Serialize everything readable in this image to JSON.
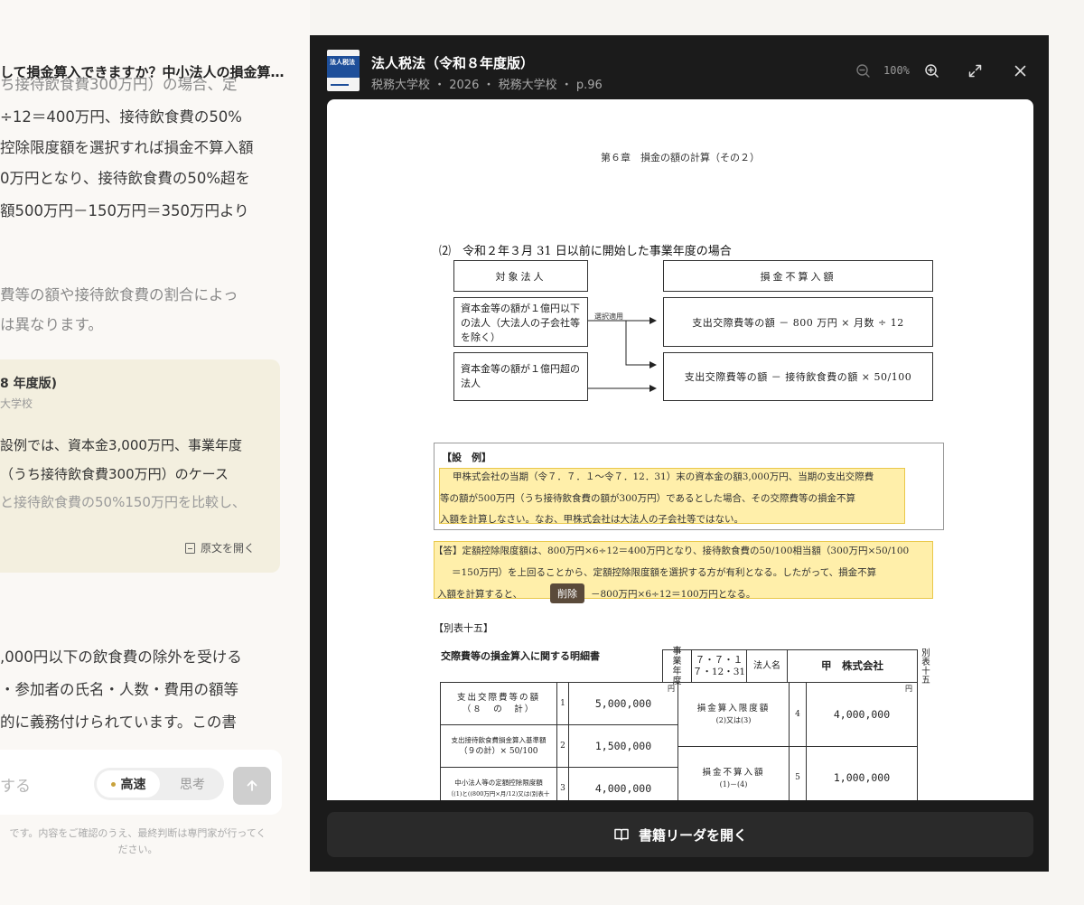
{
  "chat": {
    "answer_header": "して損金算入できますか？中小法人の損金算…",
    "lines": [
      "ち接待飲食費300万円）の場合、定",
      "÷12＝400万円、接待飲食費の50%",
      "控除限度額を選択すれば損金不算入額",
      "0万円となり、接待飲食費の50%超を",
      "額500万円－150万円＝350万円より",
      "費等の額や接待飲食費の割合によっ",
      "は異なります。",
      ",000円以下の飲食費の除外を受ける",
      "・参加者の氏名・人数・費用の額等",
      "的に義務付けられています。この書"
    ],
    "source_card": {
      "title": "8 年度版)",
      "subtitle": "大学校",
      "lines": [
        "設例では、資本金3,000万円、事業年度",
        "（うち接待飲食費300万円）のケース",
        "と接待飲食費の50%150万円を比較し、"
      ],
      "open_label": "原文を開く"
    },
    "input": {
      "placeholder": "する",
      "mode_fast": "高速",
      "mode_think": "思考"
    },
    "disclaimer": [
      "です。内容をご確認のうえ、最終判断は専門家が行ってく",
      "ださい。"
    ]
  },
  "viewer": {
    "book_thumb_text": "法人税法",
    "title": "法人税法（令和８年度版）",
    "meta": "税務大学校 ・ 2026 ・ 税務大学校 ・ p.96",
    "zoom": "100%",
    "open_reader_label": "書籍リーダを開く",
    "icons": {
      "zoom_out": "zoom-out-icon",
      "zoom_in": "zoom-in-icon",
      "expand": "expand-icon",
      "close": "close-icon",
      "book": "book-open-icon"
    }
  },
  "pdf": {
    "chapter": "第６章　損金の額の計算（その２）",
    "section": "⑵　令和２年３月 31 日以前に開始した事業年度の場合",
    "col_left": "対象法人",
    "col_right": "損金不算入額",
    "left_box_1": "資本金等の額が１億円以下の法人（大法人の子会社等を除く）",
    "left_box_2": "資本金等の額が１億円超の法人",
    "arrow_label": "選択適用",
    "right_box_1": "支出交際費等の額 － 800 万円 × 月数 ÷ 12",
    "right_box_2": "支出交際費等の額 － 接待飲食費の額 × 50/100",
    "example_head": "【設　例】",
    "example_lines": [
      "甲株式会社の当期（令７．７．１～令７．12．31）末の資本金の額3,000万円、当期の支出交際費",
      "等の額が500万円（うち接待飲食費の額が300万円）であるとした場合、その交際費等の損金不算",
      "入額を計算しなさい。なお、甲株式会社は大法人の子会社等ではない。"
    ],
    "answer_lines": [
      "【答】定額控除限度額は、800万円×6÷12＝400万円となり、接待飲食費の50/100相当額（300万円×50/100",
      "＝150万円）を上回ることから、定額控除限度額を選択する方が有利となる。したがって、損金不算",
      "入額を計算すると、",
      "－800万円×6÷12＝100万円となる。"
    ],
    "tooltip": "削除",
    "beppyo": "【別表十五】",
    "form": {
      "title": "交際費等の損金算入に関する明細書",
      "year_label": "事業年度",
      "year_from": "７・７・１",
      "year_to": "７・12・31",
      "corp_label": "法人名",
      "corp_name": "甲　株式会社",
      "side_label": "別表十五",
      "yen": "円",
      "rows": [
        {
          "label": "支出交際費等の額",
          "sub": "（８　の　計）",
          "no": "1",
          "value": "5,000,000"
        },
        {
          "label": "支出接待飲食費損金算入基準額",
          "sub": "（９の計）× 50/100",
          "no": "2",
          "value": "1,500,000"
        },
        {
          "label": "中小法人等の定額控除限度額",
          "sub": "（(1)と((800万円×月/12)又は(別表十",
          "no": "3",
          "value": "4,000,000"
        }
      ],
      "right_rows": [
        {
          "label": "損金算入限度額",
          "sub": "(2)又は(3)",
          "no": "4",
          "value": "4,000,000"
        },
        {
          "label": "損金不算入額",
          "sub": "(1)－(4)",
          "no": "5",
          "value": "1,000,000"
        }
      ]
    }
  }
}
